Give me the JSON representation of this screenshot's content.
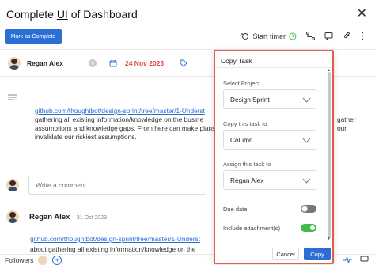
{
  "header": {
    "title_prefix": "Complete ",
    "title_underlined": "UI",
    "title_suffix": " of Dashboard",
    "mark_complete_label": "Mark as Complete",
    "start_timer_label": "Start timer"
  },
  "task": {
    "assignee": "Regan Alex",
    "due_date": "24 Nov 2023",
    "description_link": "github.com/thoughtbot/design-sprint/tree/master/1-Underst",
    "description_lines": [
      "gathering all existing information/knowledge on the busine",
      "assumptions and knowledge gaps. From here can make plans",
      "invalidate our riskiest assumptions."
    ],
    "description_right": [
      "gather",
      "our"
    ]
  },
  "comment_input": {
    "placeholder": "Write a comment"
  },
  "comment": {
    "author": "Regan Alex",
    "date": "31 Oct 2023",
    "link": "github.com/thoughtbot/design-sprint/tree/master/1-Underst",
    "text": "about gathering all existing information/knowledge on the"
  },
  "footer": {
    "followers_label": "Followers"
  },
  "modal": {
    "title": "Copy Task",
    "project_label": "Select Project",
    "project_value": "Design Sprint",
    "copy_to_label": "Copy this task to",
    "copy_to_value": "Column",
    "assign_label": "Assign this task to",
    "assign_value": "Regan Alex",
    "due_date_label": "Due date",
    "due_date_on": false,
    "attachments_label": "Include attachment(s)",
    "attachments_on": true,
    "cancel_label": "Cancel",
    "copy_label": "Copy"
  },
  "colors": {
    "accent": "#2b6fd6",
    "modal_border": "#e35d4a",
    "due_date": "#e0463b",
    "toggle_on": "#3ebd4a"
  }
}
